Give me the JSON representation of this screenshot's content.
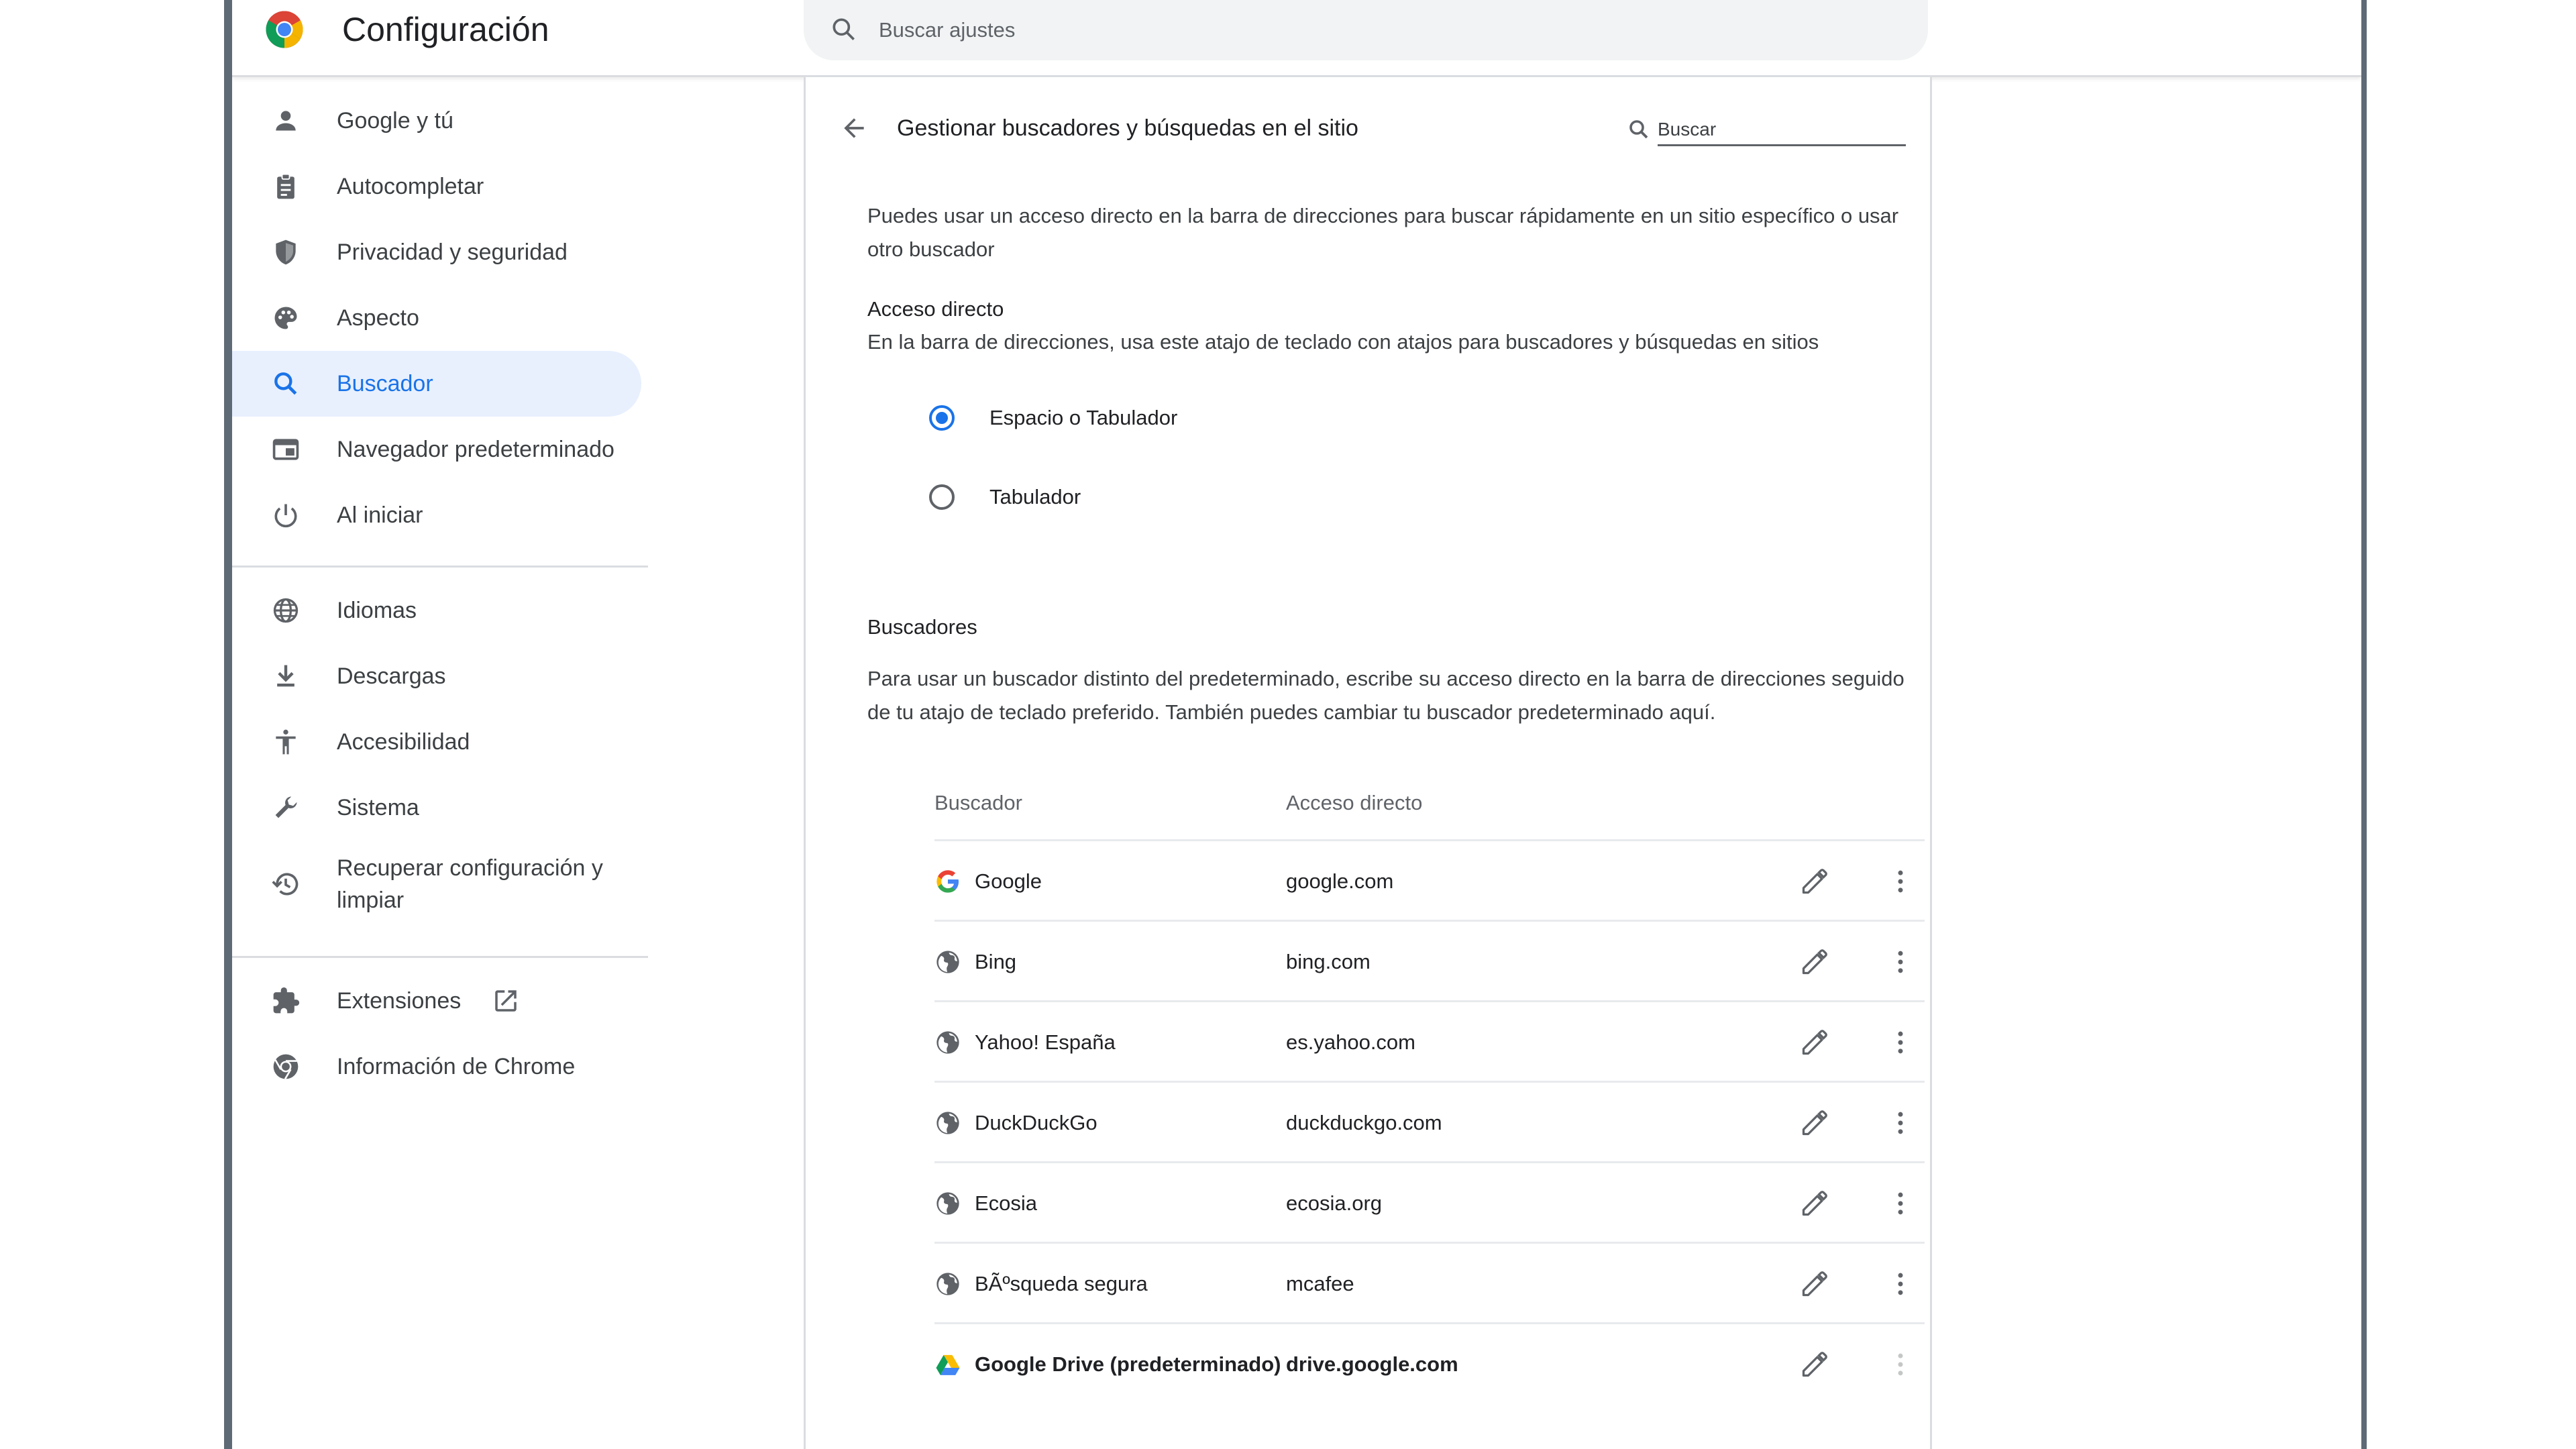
{
  "header": {
    "title": "Configuración",
    "search_placeholder": "Buscar ajustes"
  },
  "sidebar": {
    "items": [
      {
        "label": "Google y tú",
        "icon": "person-icon"
      },
      {
        "label": "Autocompletar",
        "icon": "clipboard-icon"
      },
      {
        "label": "Privacidad y seguridad",
        "icon": "shield-icon"
      },
      {
        "label": "Aspecto",
        "icon": "palette-icon"
      },
      {
        "label": "Buscador",
        "icon": "search-icon",
        "active": true
      },
      {
        "label": "Navegador predeterminado",
        "icon": "browser-window-icon"
      },
      {
        "label": "Al iniciar",
        "icon": "power-icon"
      },
      {
        "label": "Idiomas",
        "icon": "globe-icon"
      },
      {
        "label": "Descargas",
        "icon": "download-icon"
      },
      {
        "label": "Accesibilidad",
        "icon": "accessibility-icon"
      },
      {
        "label": "Sistema",
        "icon": "wrench-icon"
      },
      {
        "label": "Recuperar configuración y limpiar",
        "icon": "restore-icon"
      },
      {
        "label": "Extensiones",
        "icon": "puzzle-icon"
      },
      {
        "label": "Información de Chrome",
        "icon": "chrome-icon"
      }
    ]
  },
  "content": {
    "title": "Gestionar buscadores y búsquedas en el sitio",
    "search_placeholder": "Buscar",
    "intro": "Puedes usar un acceso directo en la barra de direcciones para buscar rápidamente en un sitio específico o usar otro buscador",
    "shortcut": {
      "title": "Acceso directo",
      "description": "En la barra de direcciones, usa este atajo de teclado con atajos para buscadores y búsquedas en sitios",
      "options": [
        {
          "label": "Espacio o Tabulador",
          "checked": true
        },
        {
          "label": "Tabulador",
          "checked": false
        }
      ]
    },
    "engines": {
      "title": "Buscadores",
      "description": "Para usar un buscador distinto del predeterminado, escribe su acceso directo en la barra de direcciones seguido de tu atajo de teclado preferido. También puedes cambiar tu buscador predeterminado aquí.",
      "columns": [
        "Buscador",
        "Acceso directo"
      ],
      "rows": [
        {
          "name": "Google",
          "keyword": "google.com",
          "icon": "google-g-icon"
        },
        {
          "name": "Bing",
          "keyword": "bing.com",
          "icon": "globe-icon"
        },
        {
          "name": "Yahoo! España",
          "keyword": "es.yahoo.com",
          "icon": "globe-icon"
        },
        {
          "name": "DuckDuckGo",
          "keyword": "duckduckgo.com",
          "icon": "globe-icon"
        },
        {
          "name": "Ecosia",
          "keyword": "ecosia.org",
          "icon": "globe-icon"
        },
        {
          "name": "BÃºsqueda segura",
          "keyword": "mcafee",
          "icon": "globe-icon"
        },
        {
          "name": "Google Drive (predeterminado)",
          "keyword": "drive.google.com",
          "icon": "google-drive-icon",
          "default": true
        }
      ]
    }
  },
  "colors": {
    "accent": "#1a73e8",
    "active_bg": "#e8f0fe",
    "icon_gray": "#5f6368"
  }
}
